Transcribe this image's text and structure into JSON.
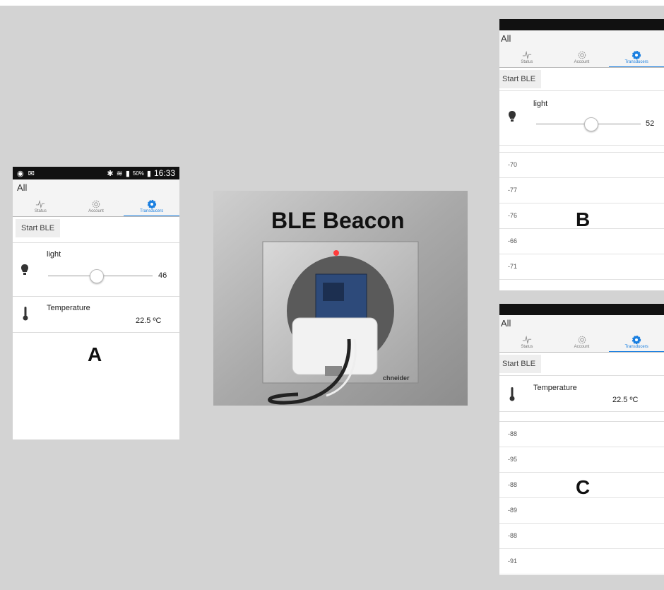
{
  "labels": {
    "a": "A",
    "b": "B",
    "c": "C",
    "beacon": "BLE Beacon"
  },
  "status_bar": {
    "battery": "50%",
    "time": "16:33"
  },
  "app": {
    "title": "All",
    "tabs": [
      {
        "label": "Status",
        "icon": "pulse-icon"
      },
      {
        "label": "Account",
        "icon": "gear-outline-icon"
      },
      {
        "label": "Transducers",
        "icon": "gear-filled-icon",
        "active": true
      }
    ],
    "start_ble": "Start BLE"
  },
  "screen_a": {
    "light": {
      "name": "light",
      "value": "46",
      "level": 0.46
    },
    "temperature": {
      "name": "Temperature",
      "value": "22.5 ºC"
    }
  },
  "screen_b": {
    "light": {
      "name": "light",
      "value": "52",
      "level": 0.52
    },
    "rssi": [
      "-70",
      "-77",
      "-76",
      "-66",
      "-71"
    ]
  },
  "screen_c": {
    "temperature": {
      "name": "Temperature",
      "value": "22.5 ºC"
    },
    "rssi": [
      "-88",
      "-95",
      "-88",
      "-89",
      "-88",
      "-91"
    ]
  },
  "colors": {
    "accent": "#1a7fe0",
    "background": "#d3d3d3"
  }
}
